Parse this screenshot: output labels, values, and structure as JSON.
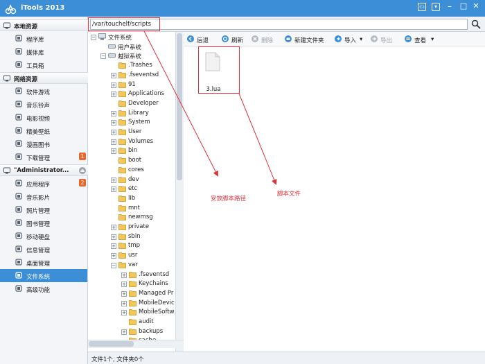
{
  "app": {
    "title": "iTools 2013"
  },
  "sidebar": {
    "sections": [
      {
        "label": "本地资源",
        "items": [
          {
            "label": "程序库"
          },
          {
            "label": "媒体库"
          },
          {
            "label": "工具箱"
          }
        ]
      },
      {
        "label": "网络资源",
        "items": [
          {
            "label": "软件游戏"
          },
          {
            "label": "音乐铃声"
          },
          {
            "label": "电影视频"
          },
          {
            "label": "精美壁纸"
          },
          {
            "label": "漫画图书"
          },
          {
            "label": "下载管理",
            "badge": "1"
          }
        ]
      },
      {
        "label": "\"Administrator...",
        "items": [
          {
            "label": "应用程序",
            "badge": "2"
          },
          {
            "label": "音乐影片"
          },
          {
            "label": "照片管理"
          },
          {
            "label": "图书管理"
          },
          {
            "label": "移动硬盘"
          },
          {
            "label": "信息管理"
          },
          {
            "label": "桌面管理"
          },
          {
            "label": "文件系统",
            "active": true
          },
          {
            "label": "高级功能"
          }
        ]
      }
    ]
  },
  "address": {
    "path": "/var/touchelf/scripts"
  },
  "tree": {
    "root": "文件系统",
    "user_fs": "用户系统",
    "jail_fs": "越狱系统",
    "folders": [
      ".Trashes",
      ".fseventsd",
      "91",
      "Applications",
      "Developer",
      "Library",
      "System",
      "User",
      "Volumes",
      "bin",
      "boot",
      "cores",
      "dev",
      "etc",
      "lib",
      "mnt",
      "newmsg",
      "private",
      "sbin",
      "tmp",
      "usr",
      "var"
    ],
    "var_children": [
      ".fseventsd",
      "Keychains",
      "Managed Pr",
      "MobileDevic",
      "MobileSoftw",
      "audit",
      "backups",
      "cache"
    ]
  },
  "toolbar": {
    "back": "后退",
    "refresh": "刷新",
    "delete": "删除",
    "new_folder": "新建文件夹",
    "import": "导入",
    "export": "导出",
    "view": "查看"
  },
  "files": [
    {
      "name": "3.lua"
    }
  ],
  "status": {
    "text": "文件1个, 文件夹0个"
  },
  "annotations": {
    "path_note": "安放脚本路径",
    "file_note": "脚本文件"
  },
  "colors": {
    "accent": "#3c8fd6",
    "badge": "#e8672f",
    "annotation": "#e0323a"
  }
}
